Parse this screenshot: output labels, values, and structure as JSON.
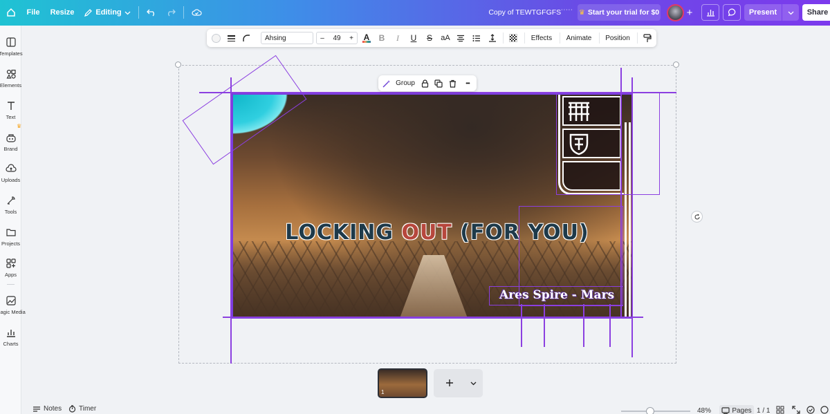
{
  "topbar": {
    "file_label": "File",
    "resize_label": "Resize",
    "editing_label": "Editing",
    "doc_title": "Copy of TEWTGFGFS˙˙˙˙˙",
    "trial_label": "Start your trial for $0",
    "present_label": "Present",
    "share_label": "Share"
  },
  "sidebar": {
    "items": [
      {
        "label": "Templates",
        "icon": "templates-icon"
      },
      {
        "label": "Elements",
        "icon": "elements-icon"
      },
      {
        "label": "Text",
        "icon": "text-icon"
      },
      {
        "label": "Brand",
        "icon": "brand-icon"
      },
      {
        "label": "Uploads",
        "icon": "uploads-icon"
      },
      {
        "label": "Tools",
        "icon": "tools-icon"
      },
      {
        "label": "Projects",
        "icon": "projects-icon"
      },
      {
        "label": "Apps",
        "icon": "apps-icon"
      },
      {
        "label": "Magic Media",
        "icon": "magic-media-icon"
      },
      {
        "label": "Charts",
        "icon": "charts-icon"
      }
    ]
  },
  "texttoolbar": {
    "font_name": "Ahsing",
    "font_size": "49",
    "minus": "–",
    "plus": "+",
    "bold": "B",
    "italic": "I",
    "underline": "U",
    "strike": "S",
    "case": "aA",
    "effects_label": "Effects",
    "animate_label": "Animate",
    "position_label": "Position"
  },
  "grouptoolbar": {
    "group_label": "Group",
    "more": "•••"
  },
  "design": {
    "title_part1": "LOCKING ",
    "title_part2": "OUT",
    "title_part3": " (FOR YOU)",
    "subtitle": "Ares Spire - Mars"
  },
  "pagestrip": {
    "page_number": "1"
  },
  "bottombar": {
    "notes_label": "Notes",
    "timer_label": "Timer",
    "zoom": "48%",
    "pages_label": "Pages",
    "page_count": "1 / 1"
  },
  "colors": {
    "accent": "#8b3fe0",
    "topbar_start": "#1fc3d3",
    "topbar_end": "#7c3aed"
  }
}
